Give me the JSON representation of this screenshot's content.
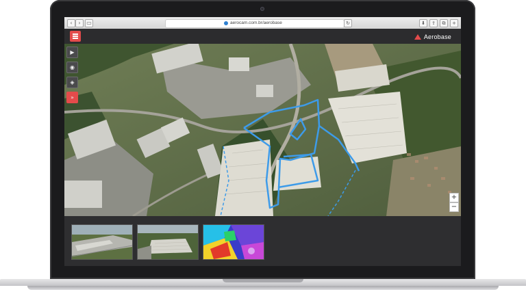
{
  "browser": {
    "url": "aerocam.com.br/aerobase"
  },
  "app": {
    "brand_name": "Aerobase",
    "accent_color": "#e44b4b",
    "menu_icon": "hamburger-menu-icon"
  },
  "map": {
    "layer": "satellite",
    "overlay_color": "#3d9be9",
    "tools": [
      {
        "name": "play-icon",
        "glyph": "▶"
      },
      {
        "name": "layers-icon",
        "glyph": "◉"
      },
      {
        "name": "info-icon",
        "glyph": "◈"
      },
      {
        "name": "collapse-icon",
        "glyph": "»"
      }
    ],
    "zoom_in": "+",
    "zoom_out": "−"
  },
  "gallery": {
    "thumbnails": [
      {
        "name": "aerial-photo-1"
      },
      {
        "name": "aerial-photo-2"
      },
      {
        "name": "thermal-map-photo"
      }
    ]
  }
}
